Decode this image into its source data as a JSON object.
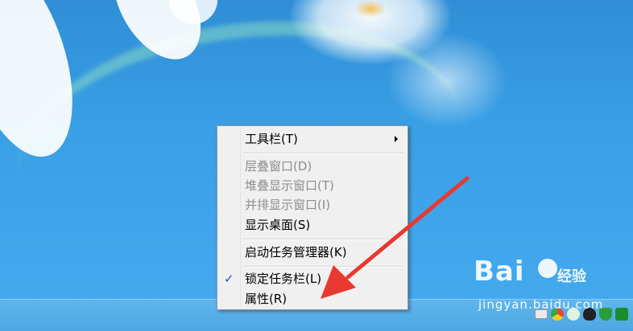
{
  "context_menu": {
    "items": [
      {
        "label": "工具栏(T)",
        "enabled": true,
        "submenu": true,
        "checked": false
      },
      {
        "label": "层叠窗口(D)",
        "enabled": false,
        "submenu": false,
        "checked": false
      },
      {
        "label": "堆叠显示窗口(T)",
        "enabled": false,
        "submenu": false,
        "checked": false
      },
      {
        "label": "并排显示窗口(I)",
        "enabled": false,
        "submenu": false,
        "checked": false
      },
      {
        "label": "显示桌面(S)",
        "enabled": true,
        "submenu": false,
        "checked": false
      },
      {
        "label": "启动任务管理器(K)",
        "enabled": true,
        "submenu": false,
        "checked": false
      },
      {
        "label": "锁定任务栏(L)",
        "enabled": true,
        "submenu": false,
        "checked": true
      },
      {
        "label": "属性(R)",
        "enabled": true,
        "submenu": false,
        "checked": false
      }
    ],
    "check_glyph": "✓"
  },
  "watermark": {
    "brand": "Bai",
    "brand2": "经验",
    "url": "jingyan.baidu.com"
  },
  "tray_icons": [
    "keyboard-icon",
    "chrome-icon",
    "wechat-icon",
    "qq-icon",
    "shield-icon",
    "plus-icon"
  ],
  "colors": {
    "arrow": "#e8392f",
    "menu_bg": "#f0f0f0",
    "disabled_text": "#8d8d8d"
  }
}
